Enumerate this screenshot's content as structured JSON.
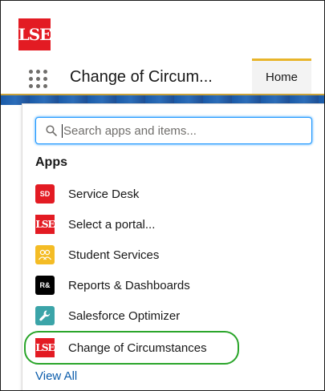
{
  "brand": {
    "logo_text": "LSE",
    "color": "#e31b23"
  },
  "header": {
    "app_title": "Change of Circum...",
    "tabs": [
      {
        "label": "Home",
        "active": true
      }
    ]
  },
  "launcher": {
    "icon": "app-launcher-grid-icon"
  },
  "search": {
    "placeholder": "Search apps and items...",
    "value": ""
  },
  "apps_section": {
    "heading": "Apps",
    "items": [
      {
        "label": "Service Desk",
        "icon_text": "SD",
        "icon_color": "#e31b23"
      },
      {
        "label": "Select a portal...",
        "icon_text": "LSE",
        "icon_color": "#e31b23"
      },
      {
        "label": "Student Services",
        "icon_text": "",
        "icon_color": "#f4bc25"
      },
      {
        "label": "Reports & Dashboards",
        "icon_text": "R&",
        "icon_color": "#000000"
      },
      {
        "label": "Salesforce Optimizer",
        "icon_text": "",
        "icon_color": "#3ba4a8"
      },
      {
        "label": "Change of Circumstances",
        "icon_text": "LSE",
        "icon_color": "#e31b23",
        "highlighted": true
      }
    ],
    "view_all": "View All"
  }
}
